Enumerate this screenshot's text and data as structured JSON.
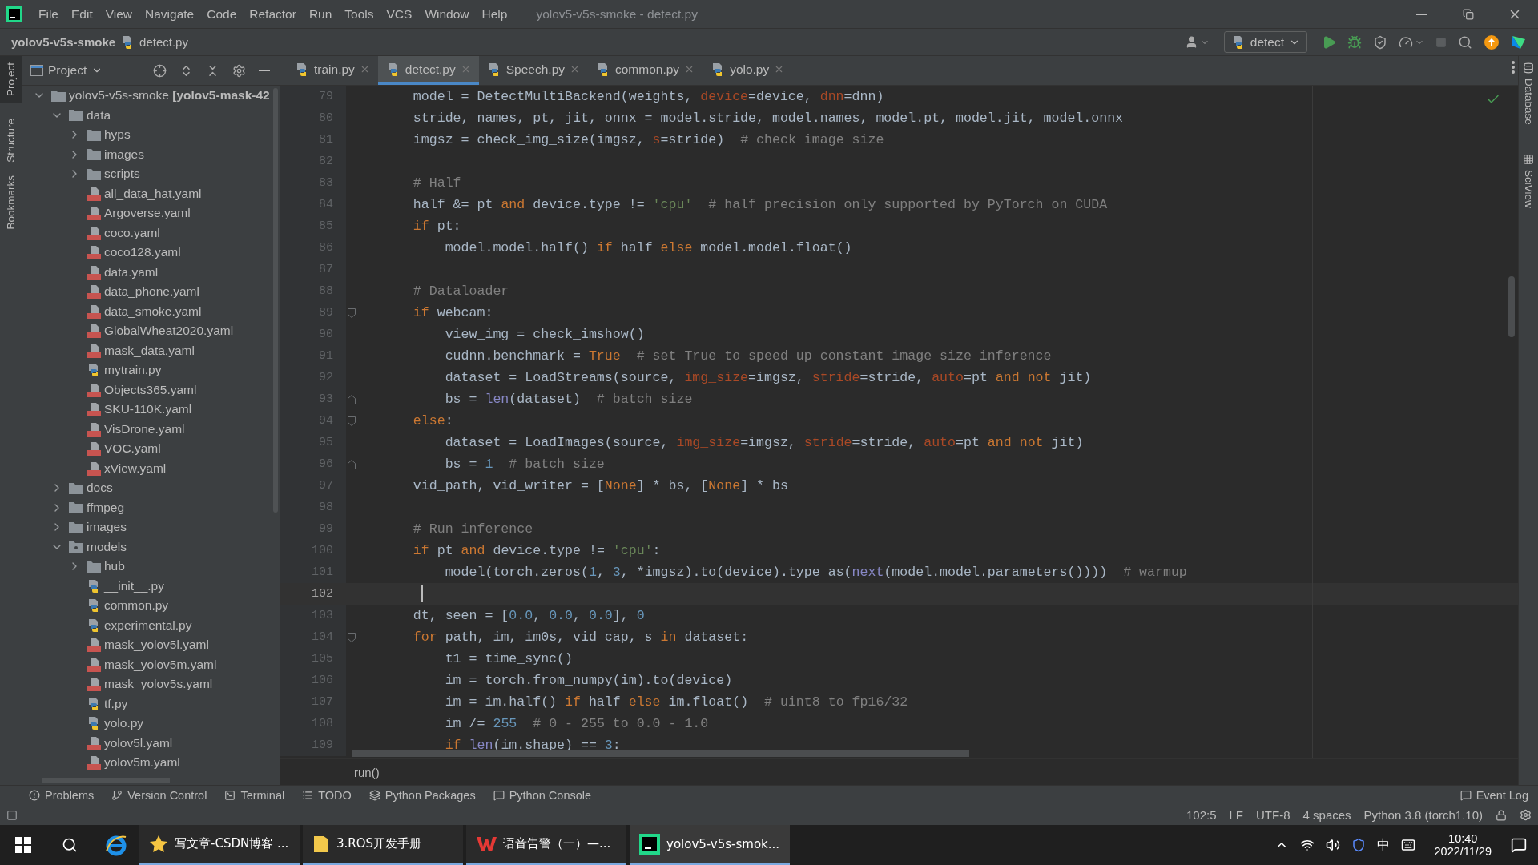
{
  "window": {
    "title": "yolov5-v5s-smoke - detect.py"
  },
  "menu": [
    "File",
    "Edit",
    "View",
    "Navigate",
    "Code",
    "Refactor",
    "Run",
    "Tools",
    "VCS",
    "Window",
    "Help"
  ],
  "breadcrumb": {
    "project": "yolov5-v5s-smoke",
    "file": "detect.py"
  },
  "run_config": "detect",
  "left_stripe": [
    {
      "label": "Project",
      "selected": true
    },
    {
      "label": "Structure",
      "selected": false
    },
    {
      "label": "Bookmarks",
      "selected": false
    }
  ],
  "project_panel": {
    "title": "Project",
    "tree": [
      {
        "label": "yolov5-v5s-smoke **[yolov5-mask-42**",
        "kind": "folder",
        "expanded": true,
        "children": [
          {
            "label": "data",
            "kind": "folder",
            "expanded": true,
            "children": [
              {
                "label": "hyps",
                "kind": "folder",
                "expanded": false
              },
              {
                "label": "images",
                "kind": "folder",
                "expanded": false
              },
              {
                "label": "scripts",
                "kind": "folder",
                "expanded": false
              },
              {
                "label": "all_data_hat.yaml",
                "kind": "yaml"
              },
              {
                "label": "Argoverse.yaml",
                "kind": "yaml"
              },
              {
                "label": "coco.yaml",
                "kind": "yaml"
              },
              {
                "label": "coco128.yaml",
                "kind": "yaml"
              },
              {
                "label": "data.yaml",
                "kind": "yaml"
              },
              {
                "label": "data_phone.yaml",
                "kind": "yaml"
              },
              {
                "label": "data_smoke.yaml",
                "kind": "yaml"
              },
              {
                "label": "GlobalWheat2020.yaml",
                "kind": "yaml"
              },
              {
                "label": "mask_data.yaml",
                "kind": "yaml"
              },
              {
                "label": "mytrain.py",
                "kind": "python"
              },
              {
                "label": "Objects365.yaml",
                "kind": "yaml"
              },
              {
                "label": "SKU-110K.yaml",
                "kind": "yaml"
              },
              {
                "label": "VisDrone.yaml",
                "kind": "yaml"
              },
              {
                "label": "VOC.yaml",
                "kind": "yaml"
              },
              {
                "label": "xView.yaml",
                "kind": "yaml"
              }
            ]
          },
          {
            "label": "docs",
            "kind": "folder",
            "expanded": false
          },
          {
            "label": "ffmpeg",
            "kind": "folder",
            "expanded": false
          },
          {
            "label": "images",
            "kind": "folder",
            "expanded": false
          },
          {
            "label": "models",
            "kind": "package",
            "expanded": true,
            "children": [
              {
                "label": "hub",
                "kind": "folder",
                "expanded": false
              },
              {
                "label": "__init__.py",
                "kind": "python"
              },
              {
                "label": "common.py",
                "kind": "python"
              },
              {
                "label": "experimental.py",
                "kind": "python"
              },
              {
                "label": "mask_yolov5l.yaml",
                "kind": "yaml"
              },
              {
                "label": "mask_yolov5m.yaml",
                "kind": "yaml"
              },
              {
                "label": "mask_yolov5s.yaml",
                "kind": "yaml"
              },
              {
                "label": "tf.py",
                "kind": "python"
              },
              {
                "label": "yolo.py",
                "kind": "python"
              },
              {
                "label": "yolov5l.yaml",
                "kind": "yaml"
              },
              {
                "label": "yolov5m.yaml",
                "kind": "yaml"
              }
            ]
          }
        ]
      }
    ]
  },
  "tabs": [
    {
      "label": "train.py",
      "selected": false
    },
    {
      "label": "detect.py",
      "selected": true
    },
    {
      "label": "Speech.py",
      "selected": false
    },
    {
      "label": "common.py",
      "selected": false
    },
    {
      "label": "yolo.py",
      "selected": false
    }
  ],
  "editor": {
    "lines": [
      {
        "n": "79",
        "current": false,
        "code": [
          {
            "kind": "plain",
            "text": "    model = DetectMultiBackend(weights, "
          },
          {
            "kind": "arg",
            "text": "device"
          },
          {
            "kind": "plain",
            "text": "=device, "
          },
          {
            "kind": "arg",
            "text": "dnn"
          },
          {
            "kind": "plain",
            "text": "=dnn)"
          }
        ]
      },
      {
        "n": "80",
        "current": false,
        "code": [
          {
            "kind": "plain",
            "text": "    stride, names, pt, jit, onnx = model.stride, model.names, model.pt, model.jit, model.onnx"
          }
        ]
      },
      {
        "n": "81",
        "current": false,
        "code": [
          {
            "kind": "plain",
            "text": "    imgsz = check_img_size(imgsz, "
          },
          {
            "kind": "arg",
            "text": "s"
          },
          {
            "kind": "plain",
            "text": "=stride)"
          },
          {
            "kind": "cmt",
            "text": "  # check image size"
          }
        ]
      },
      {
        "n": "82",
        "current": false
      },
      {
        "n": "83",
        "current": false,
        "code": [
          {
            "kind": "cmt",
            "text": "    # Half"
          }
        ]
      },
      {
        "n": "84",
        "current": false,
        "code": [
          {
            "kind": "plain",
            "text": "    half &= pt "
          },
          {
            "kind": "kw",
            "text": "and"
          },
          {
            "kind": "plain",
            "text": " device.type != "
          },
          {
            "kind": "str",
            "text": "'cpu'"
          },
          {
            "kind": "cmt",
            "text": "  # half precision only supported by PyTorch on CUDA"
          }
        ]
      },
      {
        "n": "85",
        "current": false,
        "code": [
          {
            "kind": "kw",
            "text": "    if"
          },
          {
            "kind": "plain",
            "text": " pt:"
          }
        ]
      },
      {
        "n": "86",
        "current": false,
        "code": [
          {
            "kind": "plain",
            "text": "        model.model.half() "
          },
          {
            "kind": "kw",
            "text": "if"
          },
          {
            "kind": "plain",
            "text": " half "
          },
          {
            "kind": "kw",
            "text": "else"
          },
          {
            "kind": "plain",
            "text": " model.model.float()"
          }
        ]
      },
      {
        "n": "87",
        "current": false
      },
      {
        "n": "88",
        "current": false,
        "code": [
          {
            "kind": "cmt",
            "text": "    # Dataloader"
          }
        ]
      },
      {
        "n": "89",
        "current": false,
        "kind": "foldstart",
        "code": [
          {
            "kind": "kw",
            "text": "    if"
          },
          {
            "kind": "plain",
            "text": " webcam:"
          }
        ]
      },
      {
        "n": "90",
        "current": false,
        "code": [
          {
            "kind": "plain",
            "text": "        view_img = check_imshow()"
          }
        ]
      },
      {
        "n": "91",
        "current": false,
        "code": [
          {
            "kind": "plain",
            "text": "        cudnn.benchmark = "
          },
          {
            "kind": "kw",
            "text": "True"
          },
          {
            "kind": "cmt",
            "text": "  # set True to speed up constant image size inference"
          }
        ]
      },
      {
        "n": "92",
        "current": false,
        "code": [
          {
            "kind": "plain",
            "text": "        dataset = LoadStreams(source, "
          },
          {
            "kind": "arg",
            "text": "img_size"
          },
          {
            "kind": "plain",
            "text": "=imgsz, "
          },
          {
            "kind": "arg",
            "text": "stride"
          },
          {
            "kind": "plain",
            "text": "=stride, "
          },
          {
            "kind": "arg",
            "text": "auto"
          },
          {
            "kind": "plain",
            "text": "=pt "
          },
          {
            "kind": "kw",
            "text": "and not"
          },
          {
            "kind": "plain",
            "text": " jit)"
          }
        ]
      },
      {
        "n": "93",
        "current": false,
        "kind": "foldend",
        "code": [
          {
            "kind": "plain",
            "text": "        bs = "
          },
          {
            "kind": "builtin",
            "text": "len"
          },
          {
            "kind": "plain",
            "text": "(dataset)"
          },
          {
            "kind": "cmt",
            "text": "  # batch_size"
          }
        ]
      },
      {
        "n": "94",
        "current": false,
        "kind": "foldstart",
        "code": [
          {
            "kind": "kw",
            "text": "    else"
          },
          {
            "kind": "plain",
            "text": ":"
          }
        ]
      },
      {
        "n": "95",
        "current": false,
        "code": [
          {
            "kind": "plain",
            "text": "        dataset = LoadImages(source, "
          },
          {
            "kind": "arg",
            "text": "img_size"
          },
          {
            "kind": "plain",
            "text": "=imgsz, "
          },
          {
            "kind": "arg",
            "text": "stride"
          },
          {
            "kind": "plain",
            "text": "=stride, "
          },
          {
            "kind": "arg",
            "text": "auto"
          },
          {
            "kind": "plain",
            "text": "=pt "
          },
          {
            "kind": "kw",
            "text": "and not"
          },
          {
            "kind": "plain",
            "text": " jit)"
          }
        ]
      },
      {
        "n": "96",
        "current": false,
        "kind": "foldend",
        "code": [
          {
            "kind": "plain",
            "text": "        bs = "
          },
          {
            "kind": "num",
            "text": "1"
          },
          {
            "kind": "cmt",
            "text": "  # batch_size"
          }
        ]
      },
      {
        "n": "97",
        "current": false,
        "code": [
          {
            "kind": "plain",
            "text": "    vid_path, vid_writer = ["
          },
          {
            "kind": "kw",
            "text": "None"
          },
          {
            "kind": "plain",
            "text": "] * bs, ["
          },
          {
            "kind": "kw",
            "text": "None"
          },
          {
            "kind": "plain",
            "text": "] * bs"
          }
        ]
      },
      {
        "n": "98",
        "current": false
      },
      {
        "n": "99",
        "current": false,
        "code": [
          {
            "kind": "cmt",
            "text": "    # Run inference"
          }
        ]
      },
      {
        "n": "100",
        "current": false,
        "code": [
          {
            "kind": "kw",
            "text": "    if"
          },
          {
            "kind": "plain",
            "text": " pt "
          },
          {
            "kind": "kw",
            "text": "and"
          },
          {
            "kind": "plain",
            "text": " device.type != "
          },
          {
            "kind": "str",
            "text": "'cpu'"
          },
          {
            "kind": "plain",
            "text": ":"
          }
        ]
      },
      {
        "n": "101",
        "current": false,
        "code": [
          {
            "kind": "plain",
            "text": "        model(torch.zeros("
          },
          {
            "kind": "num",
            "text": "1"
          },
          {
            "kind": "plain",
            "text": ", "
          },
          {
            "kind": "num",
            "text": "3"
          },
          {
            "kind": "plain",
            "text": ", *imgsz).to(device).type_as("
          },
          {
            "kind": "builtin",
            "text": "next"
          },
          {
            "kind": "plain",
            "text": "(model.model.parameters())))"
          },
          {
            "kind": "cmt",
            "text": "  # warmup"
          }
        ]
      },
      {
        "n": "102",
        "current": true
      },
      {
        "n": "103",
        "current": false,
        "code": [
          {
            "kind": "plain",
            "text": "    dt, seen = ["
          },
          {
            "kind": "num",
            "text": "0.0"
          },
          {
            "kind": "plain",
            "text": ", "
          },
          {
            "kind": "num",
            "text": "0.0"
          },
          {
            "kind": "plain",
            "text": ", "
          },
          {
            "kind": "num",
            "text": "0.0"
          },
          {
            "kind": "plain",
            "text": "], "
          },
          {
            "kind": "num",
            "text": "0"
          }
        ]
      },
      {
        "n": "104",
        "current": false,
        "kind": "foldstart",
        "code": [
          {
            "kind": "kw",
            "text": "    for"
          },
          {
            "kind": "plain",
            "text": " path, im, im0s, vid_cap, s "
          },
          {
            "kind": "kw",
            "text": "in"
          },
          {
            "kind": "plain",
            "text": " dataset:"
          }
        ]
      },
      {
        "n": "105",
        "current": false,
        "code": [
          {
            "kind": "plain",
            "text": "        t1 = time_sync()"
          }
        ]
      },
      {
        "n": "106",
        "current": false,
        "code": [
          {
            "kind": "plain",
            "text": "        im = torch.from_numpy(im).to(device)"
          }
        ]
      },
      {
        "n": "107",
        "current": false,
        "code": [
          {
            "kind": "plain",
            "text": "        im = im.half() "
          },
          {
            "kind": "kw",
            "text": "if"
          },
          {
            "kind": "plain",
            "text": " half "
          },
          {
            "kind": "kw",
            "text": "else"
          },
          {
            "kind": "plain",
            "text": " im.float()"
          },
          {
            "kind": "cmt",
            "text": "  # uint8 to fp16/32"
          }
        ]
      },
      {
        "n": "108",
        "current": false,
        "code": [
          {
            "kind": "plain",
            "text": "        im /= "
          },
          {
            "kind": "num",
            "text": "255"
          },
          {
            "kind": "cmt",
            "text": "  # 0 - 255 to 0.0 - 1.0"
          }
        ]
      },
      {
        "n": "109",
        "current": false,
        "code": [
          {
            "kind": "kw",
            "text": "        if"
          },
          {
            "kind": "builtin",
            "text": " len"
          },
          {
            "kind": "plain",
            "text": "(im.shape) == "
          },
          {
            "kind": "num",
            "text": "3"
          },
          {
            "kind": "plain",
            "text": ":"
          }
        ]
      }
    ]
  },
  "code_breadcrumb": "run()",
  "right_stripe": [
    {
      "label": "Database",
      "kind": "database"
    },
    {
      "label": "SciView",
      "kind": "grid"
    }
  ],
  "tool_windows": [
    {
      "label": "Problems",
      "kind": "problems"
    },
    {
      "label": "Version Control",
      "kind": "vcs"
    },
    {
      "label": "Terminal",
      "kind": "terminal"
    },
    {
      "label": "TODO",
      "kind": "todo"
    },
    {
      "label": "Python Packages",
      "kind": "packages"
    },
    {
      "label": "Python Console",
      "kind": "console"
    }
  ],
  "event_log": "Event Log",
  "status": [
    "102:5",
    "LF",
    "UTF-8",
    "4 spaces",
    "Python 3.8 (torch1.10)"
  ],
  "taskbar": {
    "apps": [
      {
        "label": "写文章-CSDN博客 ...",
        "kind": "star",
        "selected": false
      },
      {
        "label": "3.ROS开发手册",
        "kind": "folder",
        "selected": false
      },
      {
        "label": "语音告警（一）—...",
        "kind": "wps",
        "selected": false
      },
      {
        "label": "yolov5-v5s-smok...",
        "kind": "pycharm",
        "selected": true
      }
    ],
    "ime": "中",
    "time": "10:40",
    "date": "2022/11/29"
  }
}
